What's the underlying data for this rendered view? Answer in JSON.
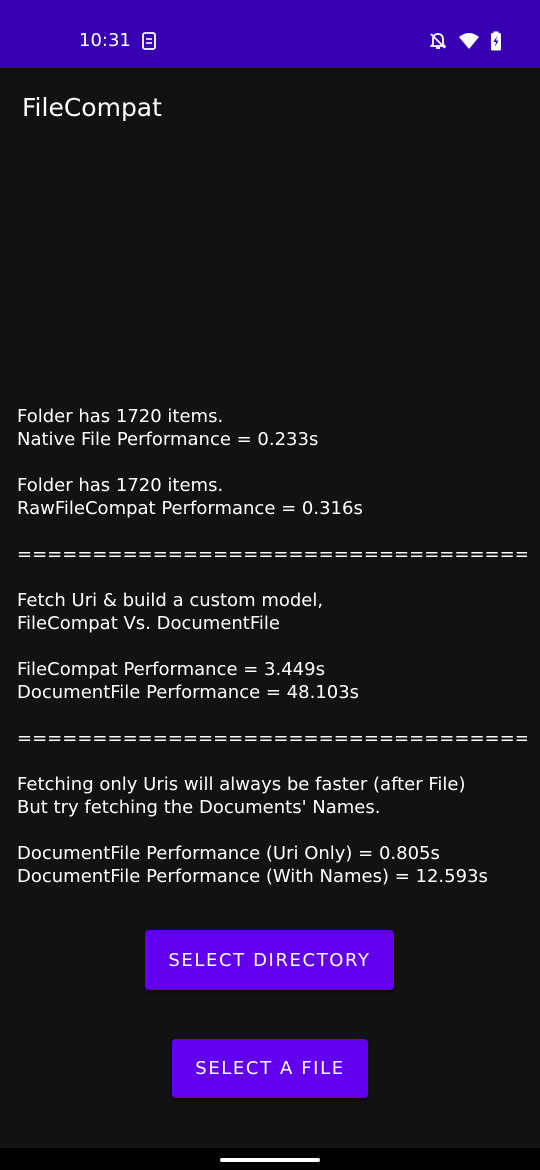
{
  "status_bar": {
    "time": "10:31",
    "background_color": "#3700b3",
    "icons": [
      "sim-card-icon",
      "bell-off-icon",
      "wifi-icon",
      "battery-charging-icon"
    ]
  },
  "app_bar": {
    "title": "FileCompat"
  },
  "results": {
    "native_count": "Folder has 1720 items.",
    "native_perf": "Native File Performance = 0.233s",
    "raw_count": "Folder has 1720 items.",
    "raw_perf": "RawFileCompat Performance = 0.316s",
    "divider_1": "================================================",
    "custom_model_line1": "Fetch Uri & build a custom model,",
    "custom_model_line2": "FileCompat Vs. DocumentFile",
    "filecompat_perf": "FileCompat Performance = 3.449s",
    "documentfile_perf": "DocumentFile Performance = 48.103s",
    "divider_2": "================================================",
    "uris_note_line1": "Fetching only Uris will always be faster (after File)",
    "uris_note_line2": "But try fetching the Documents' Names.",
    "documentfile_uri_only": "DocumentFile Performance (Uri Only) = 0.805s",
    "documentfile_with_names": "DocumentFile Performance (With Names) = 12.593s"
  },
  "buttons": {
    "select_directory": "SELECT DIRECTORY",
    "select_file": "SELECT A FILE",
    "color": "#6200ee"
  }
}
